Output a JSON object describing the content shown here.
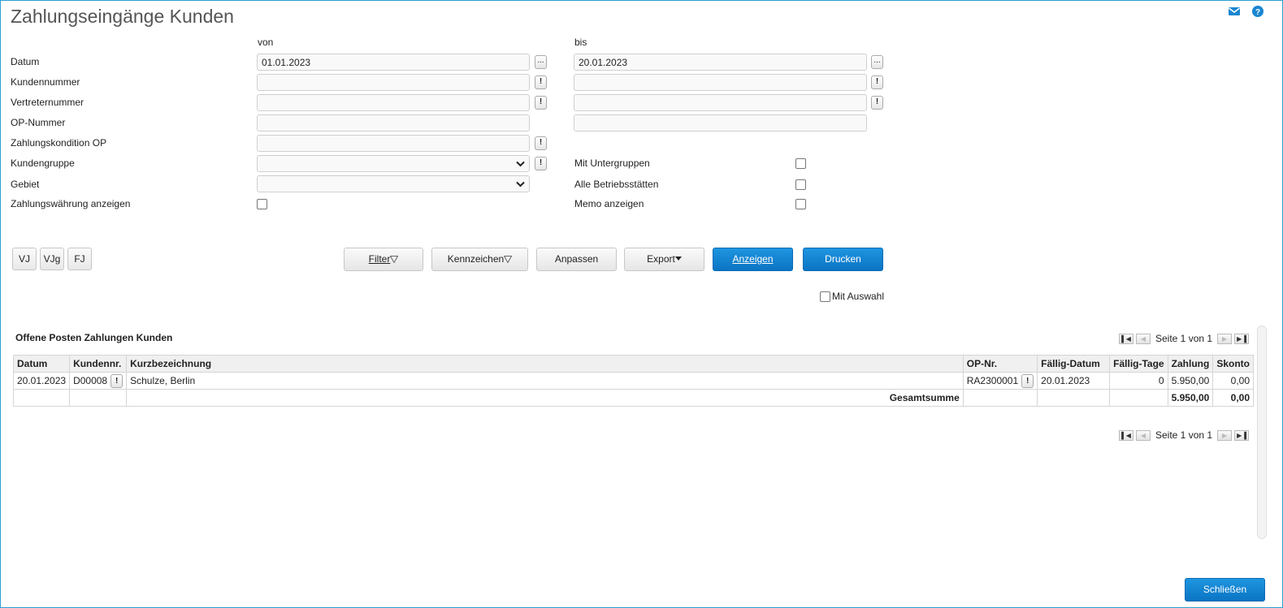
{
  "header": {
    "title": "Zahlungseingänge Kunden",
    "icons": [
      "mail-icon",
      "help-icon"
    ],
    "accent_color": "#1a86d0"
  },
  "form": {
    "col_from": "von",
    "col_to": "bis",
    "rows": {
      "datum": {
        "label": "Datum",
        "from": "01.01.2023",
        "to": "20.01.2023"
      },
      "kundennummer": {
        "label": "Kundennummer",
        "from": "",
        "to": ""
      },
      "vertreternummer": {
        "label": "Vertreternummer",
        "from": "",
        "to": ""
      },
      "op_nummer": {
        "label": "OP-Nummer",
        "from": "",
        "to": ""
      },
      "zahlungskondition": {
        "label": "Zahlungskondition OP",
        "value": ""
      },
      "kundengruppe": {
        "label": "Kundengruppe",
        "value": ""
      },
      "gebiet": {
        "label": "Gebiet",
        "value": ""
      },
      "zahlungswaehrung": {
        "label": "Zahlungswährung anzeigen"
      }
    },
    "options": {
      "mit_untergruppen": "Mit Untergruppen",
      "alle_betriebsstaetten": "Alle Betriebsstätten",
      "memo_anzeigen": "Memo anzeigen"
    },
    "browse_label": "...",
    "lookup_label": "!"
  },
  "quick_buttons": [
    "VJ",
    "VJg",
    "FJ"
  ],
  "toolbar": {
    "filter": "Filter",
    "kennzeichen": "Kennzeichen",
    "anpassen": "Anpassen",
    "export": "Export",
    "anzeigen": "Anzeigen",
    "drucken": "Drucken",
    "mit_auswahl": "Mit Auswahl"
  },
  "grid": {
    "title": "Offene Posten Zahlungen Kunden",
    "pager_text": "Seite 1 von 1",
    "columns": [
      "Datum",
      "Kundennr.",
      "Kurzbezeichnung",
      "OP-Nr.",
      "Fällig-Datum",
      "Fällig-Tage",
      "Zahlung",
      "Skonto"
    ],
    "rows": [
      {
        "datum": "20.01.2023",
        "kundennr": "D00008",
        "kurzbezeichnung": "Schulze, Berlin",
        "op_nr": "RA2300001",
        "faellig_datum": "20.01.2023",
        "faellig_tage": "0",
        "zahlung": "5.950,00",
        "skonto": "0,00"
      }
    ],
    "total": {
      "label": "Gesamtsumme",
      "zahlung": "5.950,00",
      "skonto": "0,00"
    }
  },
  "footer": {
    "close": "Schließen"
  }
}
